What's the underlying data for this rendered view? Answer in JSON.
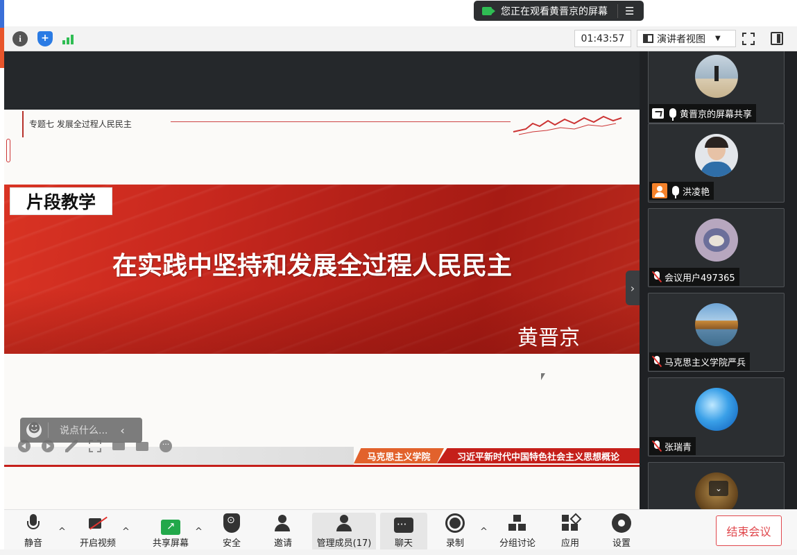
{
  "topbar": {
    "viewing_text": "您正在观看黄晋京的屏幕",
    "menu_icon": "list-icon"
  },
  "infobar": {
    "timer": "01:43:57",
    "view_mode": "演讲者视图",
    "signal_color": "#2fbd53",
    "shield_color": "#2a7be4"
  },
  "slide": {
    "topic": "专题七 发展全过程人民民主",
    "segment_tag": "片段教学",
    "title": "在实践中坚持和发展全过程人民民主",
    "author": "黄晋京",
    "footer_dept": "马克思主义学院",
    "footer_course": "习近平新时代中国特色社会主义思想概论",
    "banner_color": "#c8281e"
  },
  "chat": {
    "placeholder": "说点什么..."
  },
  "participants": [
    {
      "name": "黄晋京的屏幕共享",
      "avatar": "girl-on-beach",
      "badge": "screen-share",
      "muted": false
    },
    {
      "name": "洪凌艳",
      "avatar": "woman-portrait",
      "badge": "host-person",
      "muted": false
    },
    {
      "name": "会议用户497365",
      "avatar": "cartoon-cat",
      "badge": "",
      "muted": true
    },
    {
      "name": "马克思主义学院严兵",
      "avatar": "lake-landscape",
      "badge": "",
      "muted": true
    },
    {
      "name": "张瑞青",
      "avatar": "blue-wave",
      "badge": "",
      "muted": true
    },
    {
      "name": "",
      "avatar": "cartoon-bear",
      "badge": "",
      "muted": true
    }
  ],
  "toolbar": {
    "mute": "静音",
    "video": "开启视频",
    "share": "共享屏幕",
    "safety": "安全",
    "invite": "邀请",
    "members": "管理成员(17)",
    "chat": "聊天",
    "record": "录制",
    "breakout": "分组讨论",
    "apps": "应用",
    "settings": "设置",
    "end": "结束会议",
    "end_color": "#e0474c",
    "share_color": "#22a84a"
  }
}
